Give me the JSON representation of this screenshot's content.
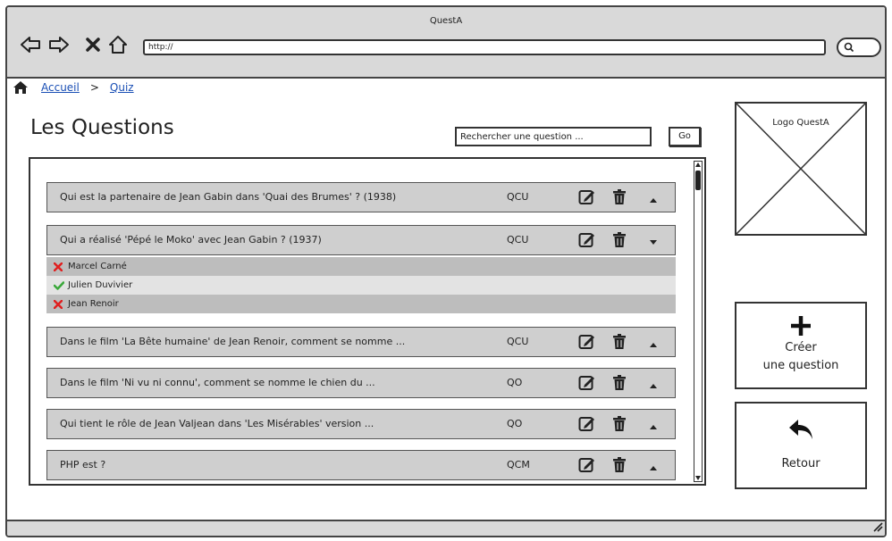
{
  "window": {
    "title": "QuestA"
  },
  "browser": {
    "url": "http://",
    "icons": [
      "back-arrow-icon",
      "forward-arrow-icon",
      "close-icon",
      "home-outline-icon",
      "search-icon"
    ]
  },
  "breadcrumb": {
    "home_icon": "home-icon",
    "items": [
      "Accueil",
      "Quiz"
    ],
    "separator": ">"
  },
  "page": {
    "title": "Les Questions"
  },
  "search": {
    "placeholder": "Rechercher une question ...",
    "go_label": "Go"
  },
  "questions": [
    {
      "text": "Qui est la partenaire de Jean Gabin dans 'Quai des Brumes' ? (1938)",
      "type": "QCU",
      "caret": "up"
    },
    {
      "text": "Qui a réalisé 'Pépé le Moko' avec Jean Gabin ? (1937)",
      "type": "QCU",
      "caret": "down",
      "answers": [
        {
          "label": "Marcel Carné",
          "correct": false
        },
        {
          "label": "Julien Duvivier",
          "correct": true
        },
        {
          "label": "Jean Renoir",
          "correct": false
        }
      ]
    },
    {
      "text": "Dans le film 'La Bête humaine' de Jean Renoir, comment se nomme ...",
      "type": "QCU",
      "caret": "up"
    },
    {
      "text": "Dans le film 'Ni vu ni connu', comment se nomme le chien du ...",
      "type": "QO",
      "caret": "up"
    },
    {
      "text": "Qui tient le rôle de Jean Valjean dans 'Les Misérables' version ...",
      "type": "QO",
      "caret": "up"
    },
    {
      "text": "PHP est ?",
      "type": "QCM",
      "caret": "up"
    }
  ],
  "logo": {
    "label": "Logo QuestA"
  },
  "actions": {
    "create": {
      "line1": "Créer",
      "line2": "une question",
      "icon": "plus-icon"
    },
    "back": {
      "label": "Retour",
      "icon": "reply-arrow-icon"
    }
  },
  "colors": {
    "row_bg": "#cfcfcf",
    "link": "#1a4fb5",
    "correct": "#3aa83a",
    "wrong": "#e02020"
  }
}
